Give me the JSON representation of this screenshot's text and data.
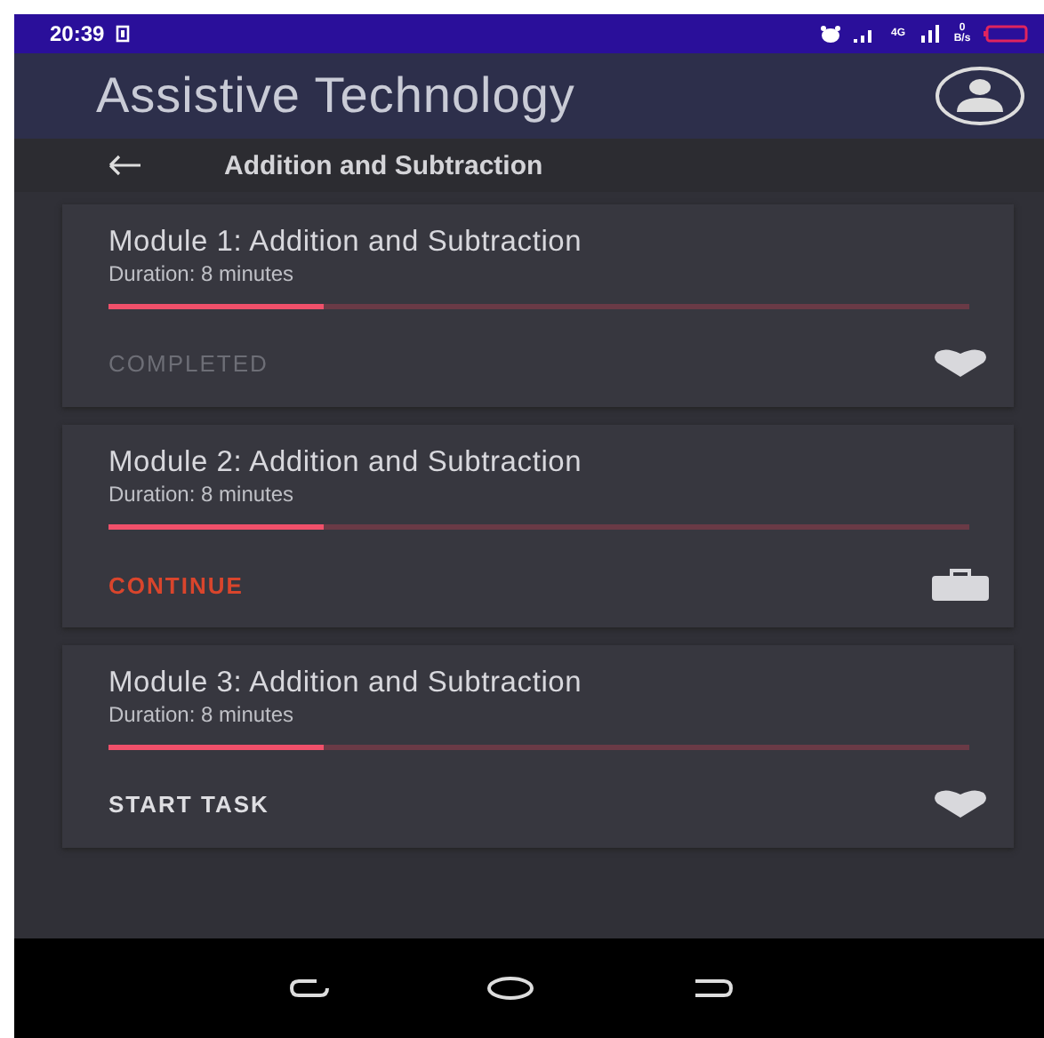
{
  "status_bar": {
    "time": "20:39",
    "network": "4G",
    "speed": "0 B/s"
  },
  "app_bar": {
    "title": "Assistive Technology"
  },
  "header": {
    "title": "Addition and Subtraction"
  },
  "modules": [
    {
      "title": "Module 1: Addition and Subtraction",
      "duration": "Duration: 8 minutes",
      "level": 0.25,
      "action": "COMPLETED",
      "kind": "completed"
    },
    {
      "title": "Module 2: Addition and Subtraction",
      "duration": "Duration: 8 minutes",
      "level": 0.25,
      "action": "CONTINUE",
      "kind": "continue"
    },
    {
      "title": "Module 3: Addition and Subtraction",
      "duration": "Duration: 8 minutes",
      "level": 0.25,
      "action": "START TASK",
      "kind": "start"
    }
  ]
}
